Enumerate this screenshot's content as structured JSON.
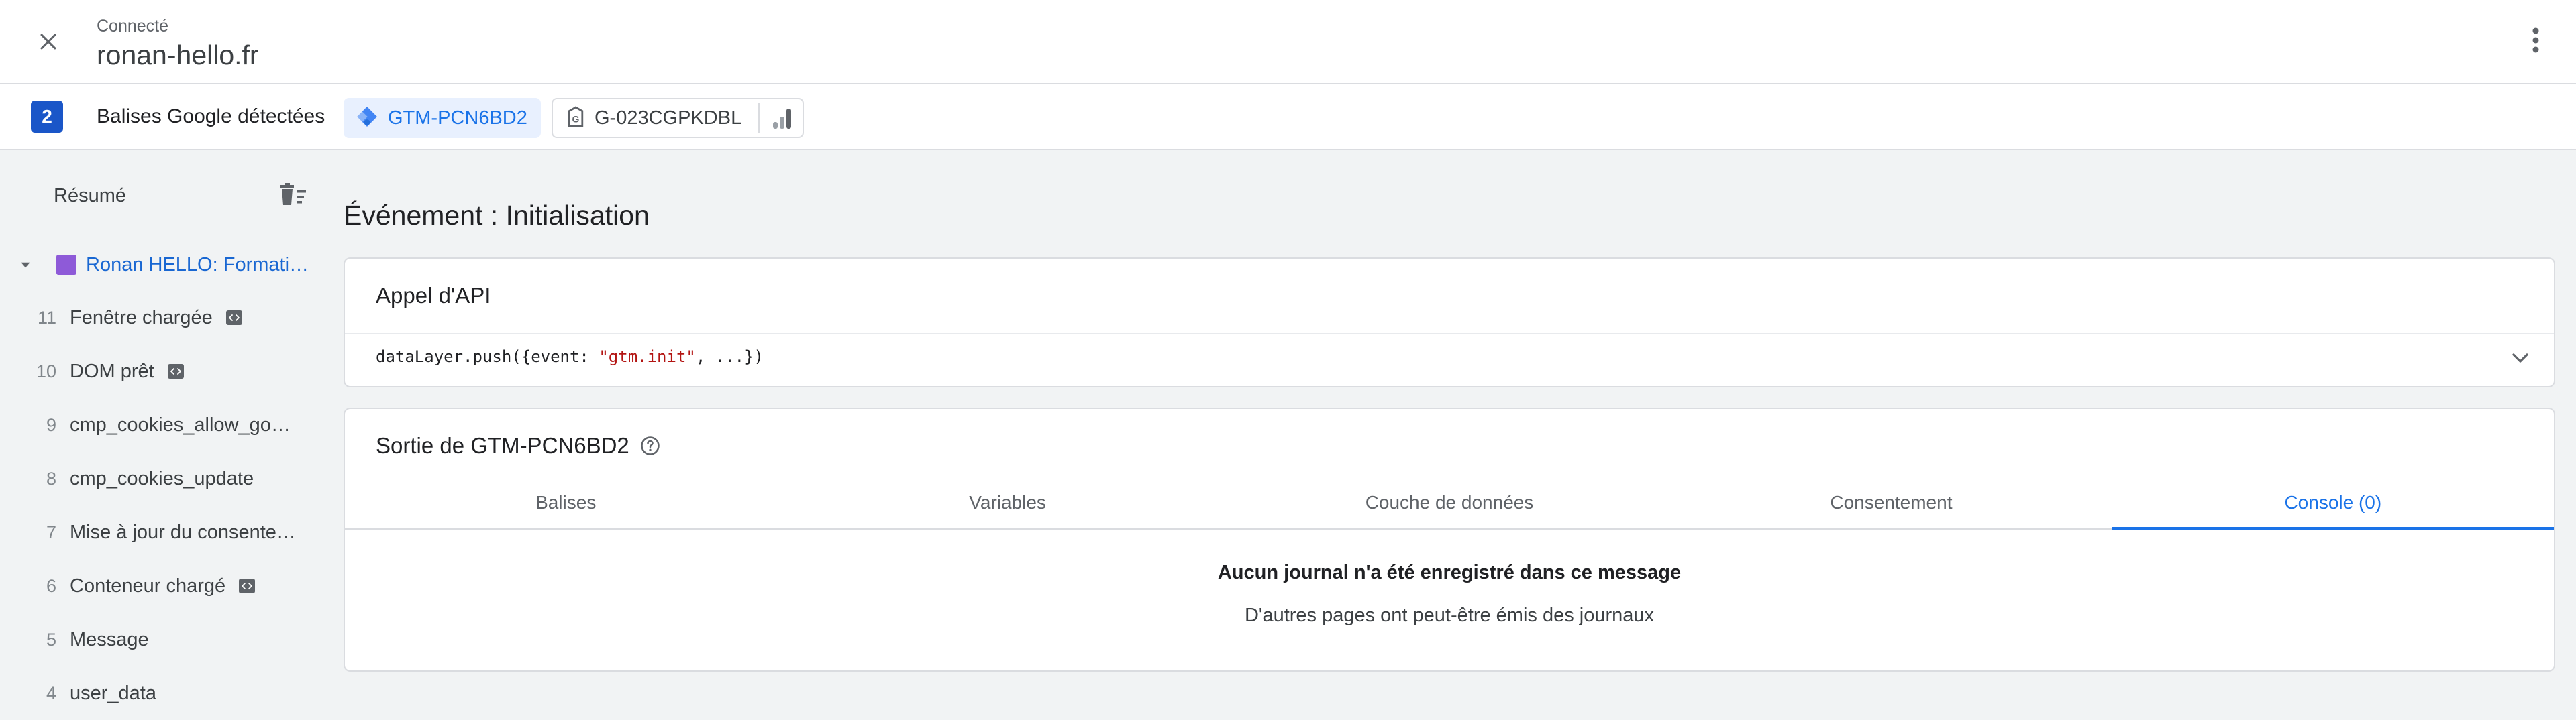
{
  "header": {
    "status": "Connecté",
    "site": "ronan-hello.fr",
    "close_icon": "close-icon",
    "more_icon": "more-vert-icon"
  },
  "tags": {
    "count": "2",
    "label": "Balises Google détectées",
    "gtm": {
      "id": "GTM-PCN6BD2",
      "icon": "gtm-diamond-icon"
    },
    "ga": {
      "id": "G-023CGPKDBL",
      "icon": "google-tag-icon",
      "side_icon": "analytics-bars-icon"
    }
  },
  "sidebar": {
    "summary_label": "Résumé",
    "clear_icon": "clear-list-icon",
    "root": {
      "label": "Ronan HELLO: Formation Analytic..."
    },
    "events": [
      {
        "num": "11",
        "name": "Fenêtre chargée",
        "code": true
      },
      {
        "num": "10",
        "name": "DOM prêt",
        "code": true
      },
      {
        "num": "9",
        "name": "cmp_cookies_allow_google_analytics",
        "code": false
      },
      {
        "num": "8",
        "name": "cmp_cookies_update",
        "code": false
      },
      {
        "num": "7",
        "name": "Mise à jour du consentement",
        "code": false
      },
      {
        "num": "6",
        "name": "Conteneur chargé",
        "code": true
      },
      {
        "num": "5",
        "name": "Message",
        "code": false
      },
      {
        "num": "4",
        "name": "user_data",
        "code": false
      }
    ]
  },
  "main": {
    "event_title": "Événement : Initialisation",
    "api": {
      "title": "Appel d'API",
      "code_prefix": "dataLayer.push({event: ",
      "code_string": "\"gtm.init\"",
      "code_suffix": ", ...})"
    },
    "output": {
      "title": "Sortie de GTM-PCN6BD2",
      "tabs": [
        "Balises",
        "Variables",
        "Couche de données",
        "Consentement",
        "Console (0)"
      ],
      "active_tab": 4,
      "empty_title": "Aucun journal n'a été enregistré dans ce message",
      "empty_sub": "D'autres pages ont peut-être émis des journaux"
    }
  },
  "colors": {
    "accent": "#1a73e8",
    "count_badge": "#1a56c8",
    "root_square": "#8e5ad8",
    "code_string": "#b31412"
  }
}
